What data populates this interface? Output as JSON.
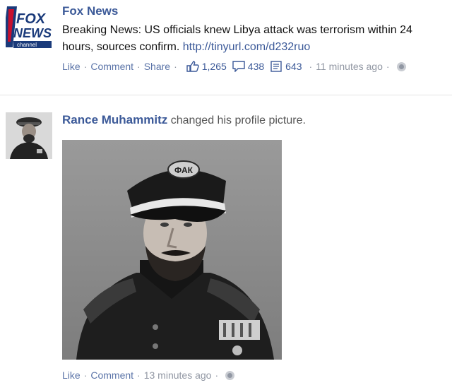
{
  "posts": [
    {
      "author": "Fox News",
      "avatar_logo": {
        "line1": "FOX",
        "line2": "NEWS",
        "line3": "channel"
      },
      "message_text": "Breaking News: US officials knew Libya attack was terrorism within 24 hours, sources confirm.",
      "message_link": "http://tinyurl.com/d232ruo",
      "actions": {
        "like": "Like",
        "comment": "Comment",
        "share": "Share"
      },
      "likes_count": "1,265",
      "comments_count": "438",
      "shares_count": "643",
      "time": "11 minutes ago",
      "privacy_icon": "globe-icon"
    },
    {
      "author": "Rance Muhammitz",
      "action_text": "changed his profile picture.",
      "photo_cap_badge": "ФАК",
      "actions": {
        "like": "Like",
        "comment": "Comment"
      },
      "time": "13 minutes ago",
      "privacy_icon": "globe-icon"
    }
  ],
  "colors": {
    "link_blue": "#3b5998",
    "meta_gray": "#9197a3",
    "fox_red": "#c8102e"
  }
}
